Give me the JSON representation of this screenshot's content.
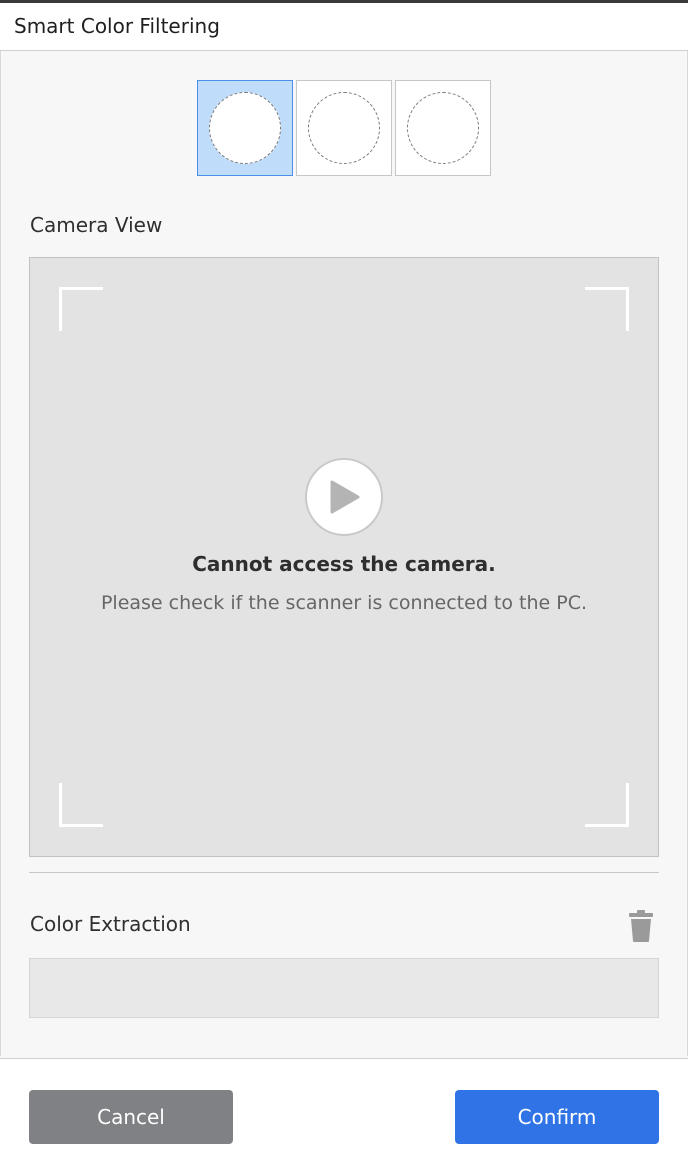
{
  "dialog": {
    "title": "Smart Color Filtering"
  },
  "color_slots": [
    {
      "selected": true
    },
    {
      "selected": false
    },
    {
      "selected": false
    }
  ],
  "camera": {
    "section_label": "Camera View",
    "error_title": "Cannot access the camera.",
    "error_message": "Please check if the scanner is connected to the PC.",
    "play_icon": "play-icon"
  },
  "extraction": {
    "section_label": "Color Extraction",
    "delete_icon": "trash-icon",
    "value": ""
  },
  "footer": {
    "cancel_label": "Cancel",
    "confirm_label": "Confirm"
  },
  "colors": {
    "accent": "#2f73e6",
    "selected_slot": "#bfdcfb",
    "cancel": "#808184"
  }
}
